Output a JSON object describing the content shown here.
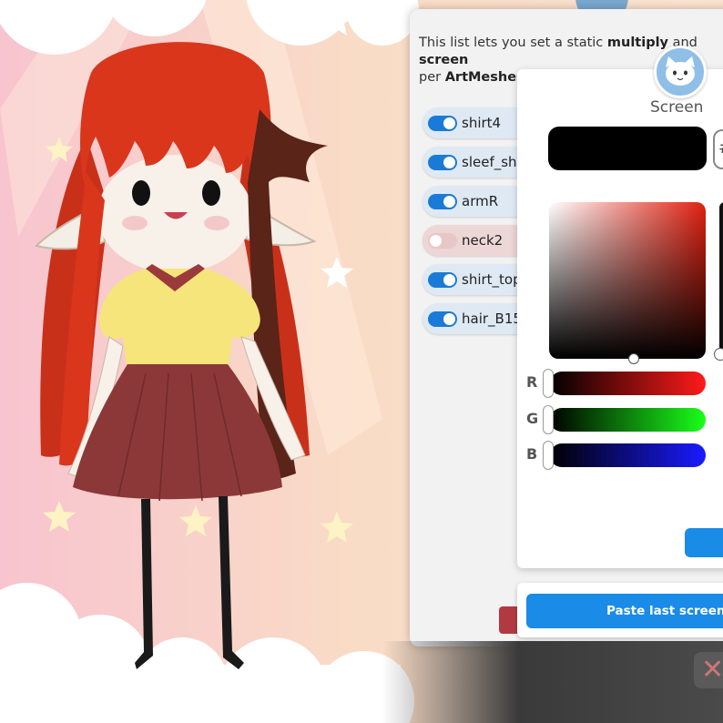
{
  "panel": {
    "description_parts": [
      "This list lets you set a static ",
      "multiply",
      " and ",
      "screen",
      " per ",
      "ArtMeshes",
      "."
    ],
    "items": [
      {
        "label": "shirt4",
        "enabled": true
      },
      {
        "label": "sleef_sh",
        "enabled": true
      },
      {
        "label": "armR",
        "enabled": true
      },
      {
        "label": "neck2",
        "enabled": false
      },
      {
        "label": "shirt_top",
        "enabled": true
      },
      {
        "label": "hair_B15",
        "enabled": true
      }
    ]
  },
  "dialog": {
    "title": "Screen",
    "swatch_color": "#000000",
    "hex_glyph": "#",
    "sliders": [
      {
        "label": "R",
        "value": 0,
        "color": "#ff1a1a"
      },
      {
        "label": "G",
        "value": 0,
        "color": "#1aff1a"
      },
      {
        "label": "B",
        "value": 0,
        "color": "#1a1aff"
      }
    ]
  },
  "paste": {
    "label": "Paste last screen co"
  },
  "close": {
    "label": "✕"
  },
  "colors": {
    "accent": "#1a8be6",
    "toggle_on": "#1a7bd6",
    "toggle_off": "#e9c6c6"
  },
  "icons": [
    "cat-avatar-icon",
    "close-icon"
  ]
}
